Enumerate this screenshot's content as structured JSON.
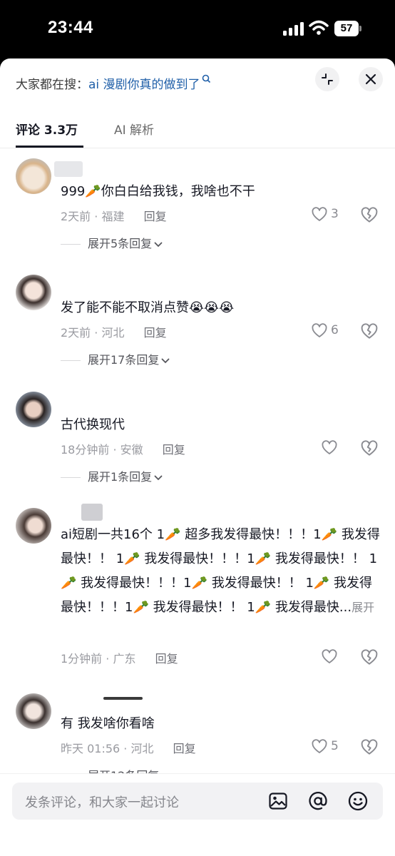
{
  "status_bar": {
    "time": "23:44",
    "battery": "57"
  },
  "search": {
    "prefix": "大家都在搜：",
    "term": "ai 漫剧你真的做到了"
  },
  "tabs": [
    {
      "label": "评论 3.3万",
      "active": true
    },
    {
      "label": "AI 解析",
      "active": false
    }
  ],
  "comments": [
    {
      "text": "999🥕你白白给我钱，我啥也不干",
      "time": "2天前",
      "location": "福建",
      "reply_label": "回复",
      "likes": "3",
      "expand_label": "展开5条回复"
    },
    {
      "text": "发了能不能不取消点赞😭😭😭",
      "time": "2天前",
      "location": "河北",
      "reply_label": "回复",
      "likes": "6",
      "expand_label": "展开17条回复"
    },
    {
      "text": "古代换现代",
      "time": "18分钟前",
      "location": "安徽",
      "reply_label": "回复",
      "likes": "",
      "expand_label": "展开1条回复"
    },
    {
      "text": "ai短剧一共16个 1🥕 超多我发得最快！！！1🥕 我发得最快！！ 1🥕 我发得最快！！！1🥕 我发得最快！！ 1🥕 我发得最快！！！1🥕 我发得最快！！ 1🥕 我发得最快！！！1🥕 我发得最快！！ 1🥕 我发得最快...",
      "expand_inline": "展开",
      "time": "1分钟前",
      "location": "广东",
      "reply_label": "回复",
      "likes": ""
    },
    {
      "text": "有 我发啥你看啥",
      "time": "昨天 01:56",
      "location": "河北",
      "reply_label": "回复",
      "likes": "5",
      "expand_label": "展开12条回复"
    }
  ],
  "input": {
    "placeholder": "发条评论，和大家一起讨论"
  },
  "icons": {
    "collapse": "collapse-icon",
    "close": "close-icon",
    "heart": "heart-icon",
    "dislike": "broken-heart-icon",
    "image": "image-icon",
    "mention": "at-icon",
    "emoji": "emoji-icon"
  }
}
